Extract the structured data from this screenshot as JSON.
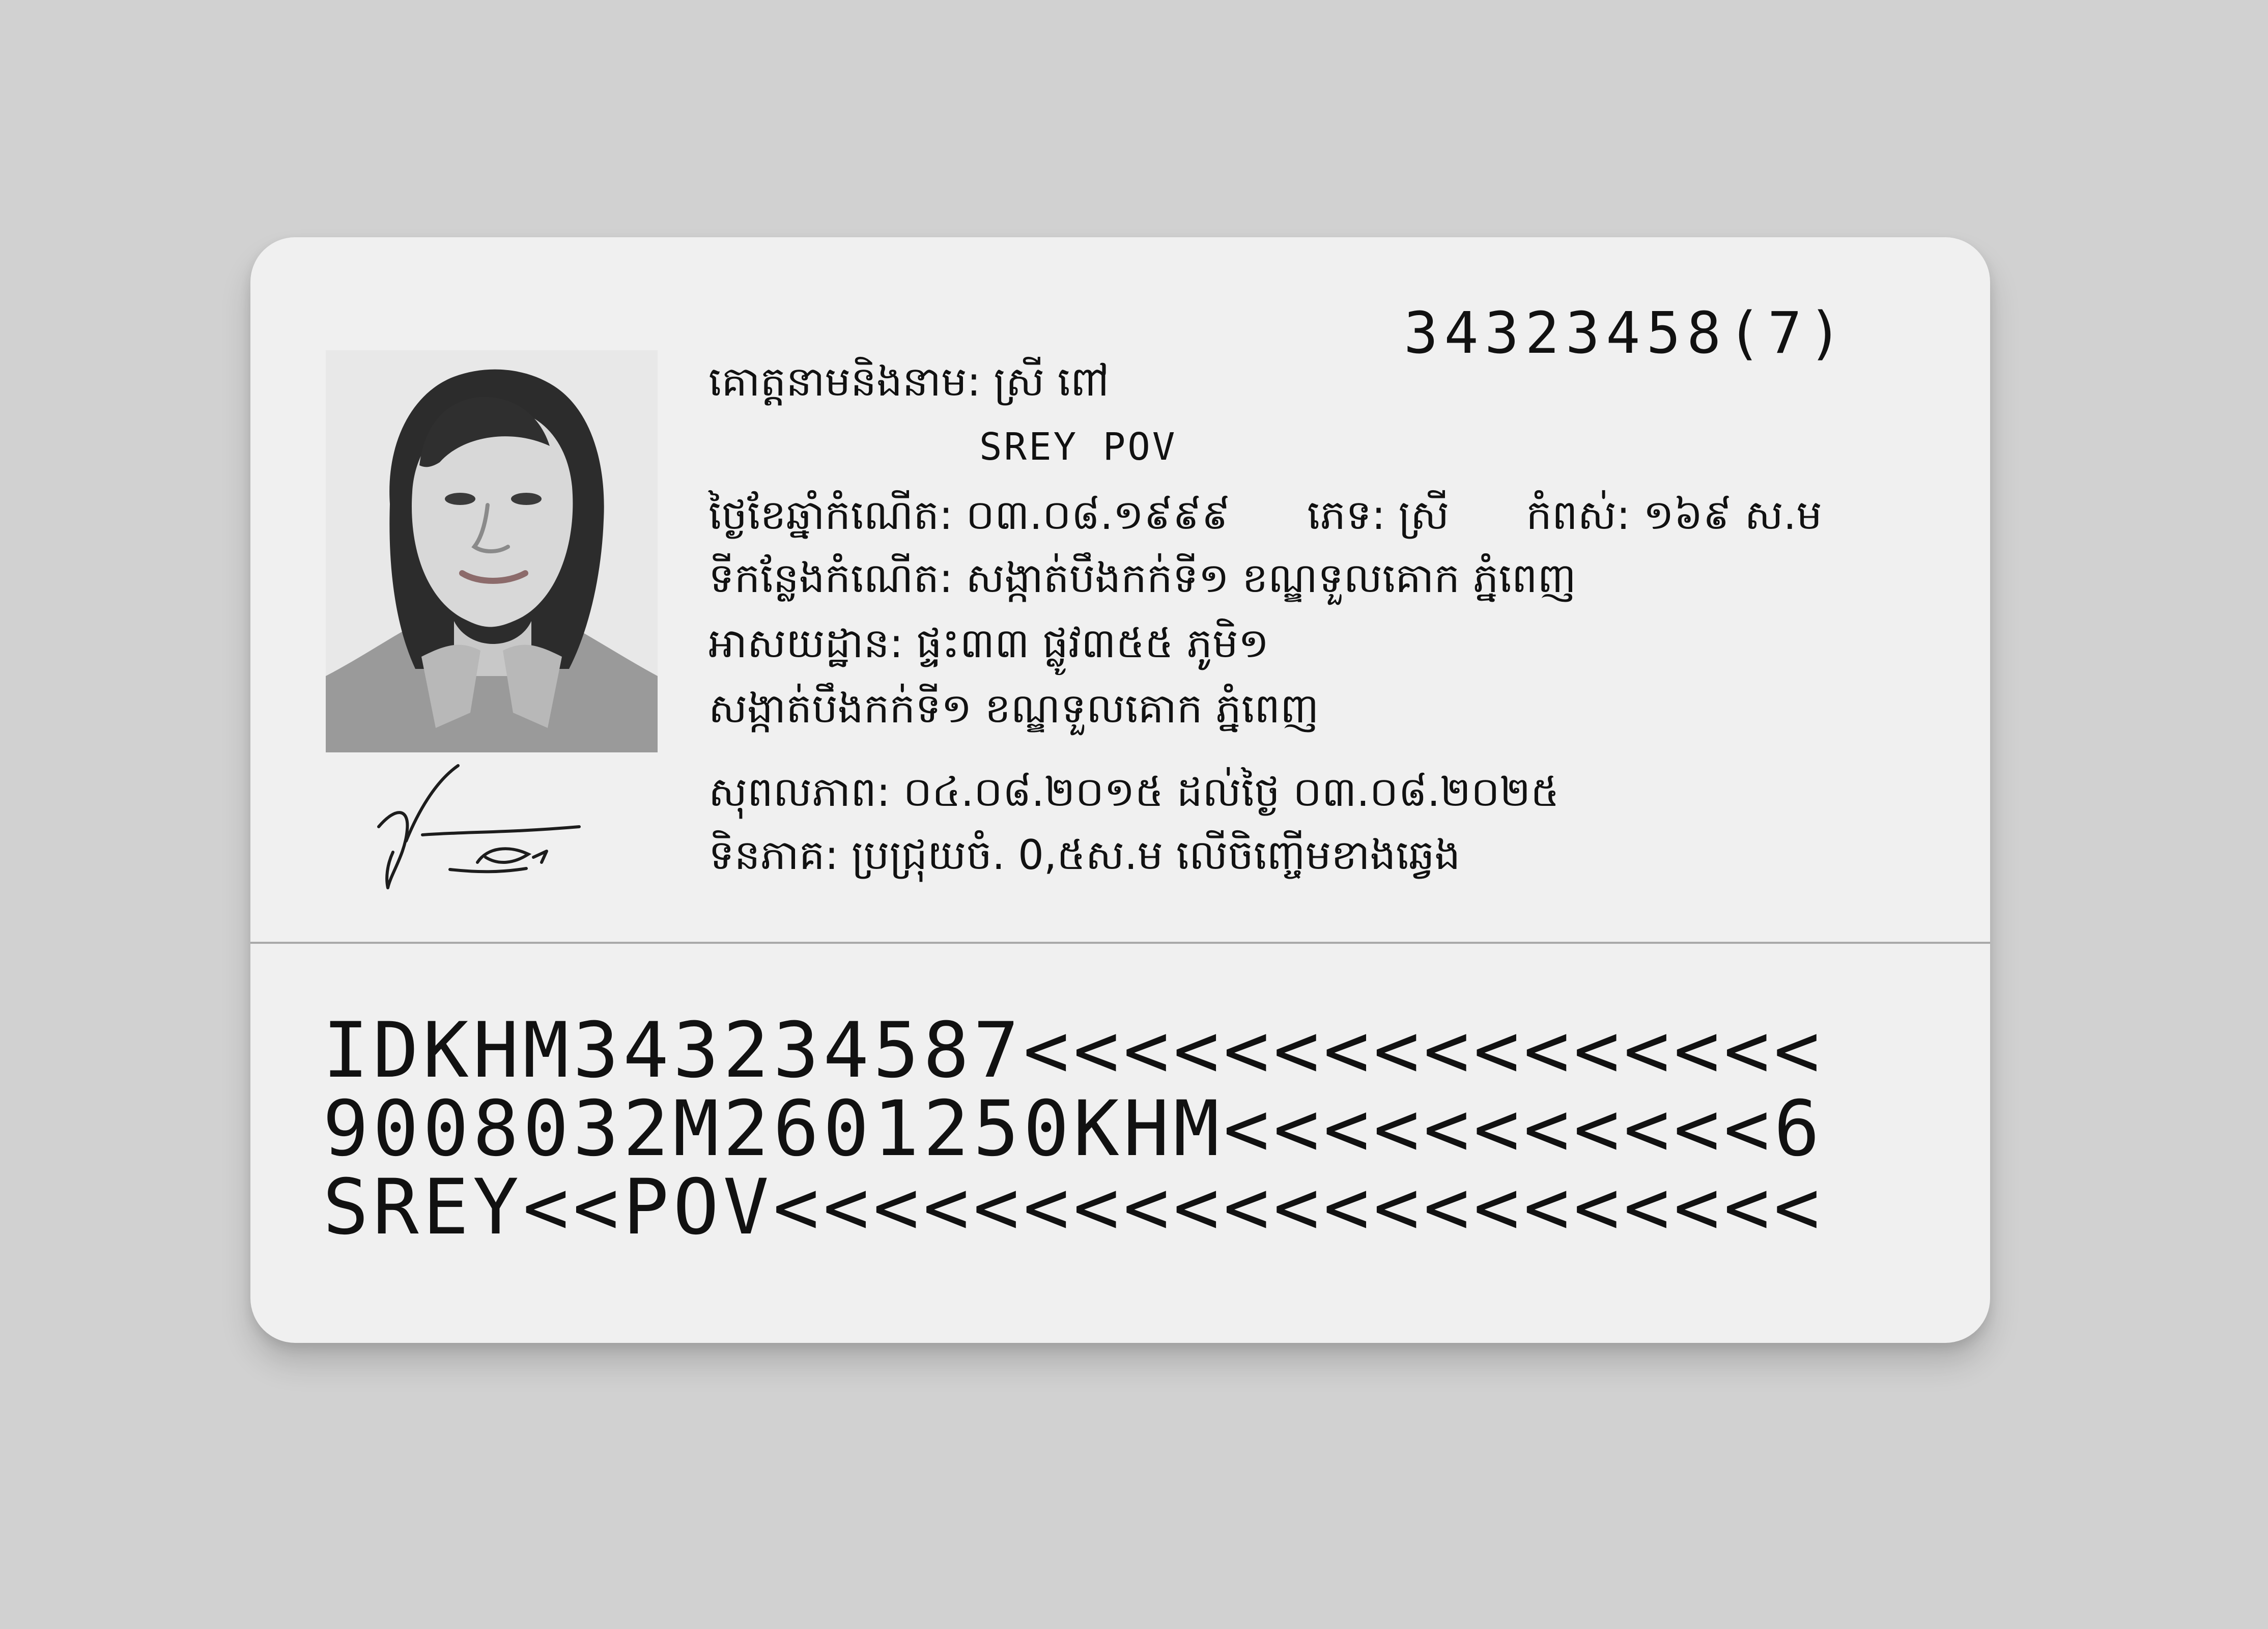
{
  "card": {
    "id_number": "34323458(7)",
    "name_label": "គោត្តនាមនិងនាម:",
    "name_khmer": "ស្រី ពៅ",
    "name_latin": "SREY POV",
    "birth_label": "ថ្ងៃខែឆ្នាំកំណើត:",
    "birth_value": "០៣.០៨.១៩៩៩",
    "sex_label": "ភេទ:",
    "sex_value": "ស្រី",
    "height_label": "កំពស់:",
    "height_value": "១៦៩ ស.ម",
    "birthplace_label": "ទីកន្លែងកំណើត:",
    "birthplace_value": "សង្កាត់បឹងកក់ទី១ ខណ្ឌទួលគោក ភ្នំពេញ",
    "address_label": "អាសយដ្ឋាន:",
    "address_line1": "ផ្ទះ៣៣ ផ្លូវ៣៥៥ ភូមិ១",
    "address_line2": "សង្កាត់បឹងកក់ទី១ ខណ្ឌទួលគោក ភ្នំពេញ",
    "validity_label": "សុពលភាព:",
    "validity_value": "០៤.០៨.២០១៥ ដល់ថ្ងៃ ០៣.០៨.២០២៥",
    "mark_label": "ទិនភាគ:",
    "mark_value": "ប្រជ្រុយចំ. 0,៥ស.ម លើចិញ្ចើមខាងឆ្វេង"
  },
  "mrz": {
    "line1": "IDKHM343234587<<<<<<<<<<<<<<<<",
    "line2": "9008032M2601250KHM<<<<<<<<<<<6",
    "line3": "SREY<<POV<<<<<<<<<<<<<<<<<<<<<"
  },
  "colors": {
    "background": "#d1d1d1",
    "card": "#f0f0f0",
    "text": "#111111",
    "divider": "#a9a9a9"
  },
  "icons": {
    "portrait": "portrait-photo",
    "signature": "signature-mark"
  }
}
